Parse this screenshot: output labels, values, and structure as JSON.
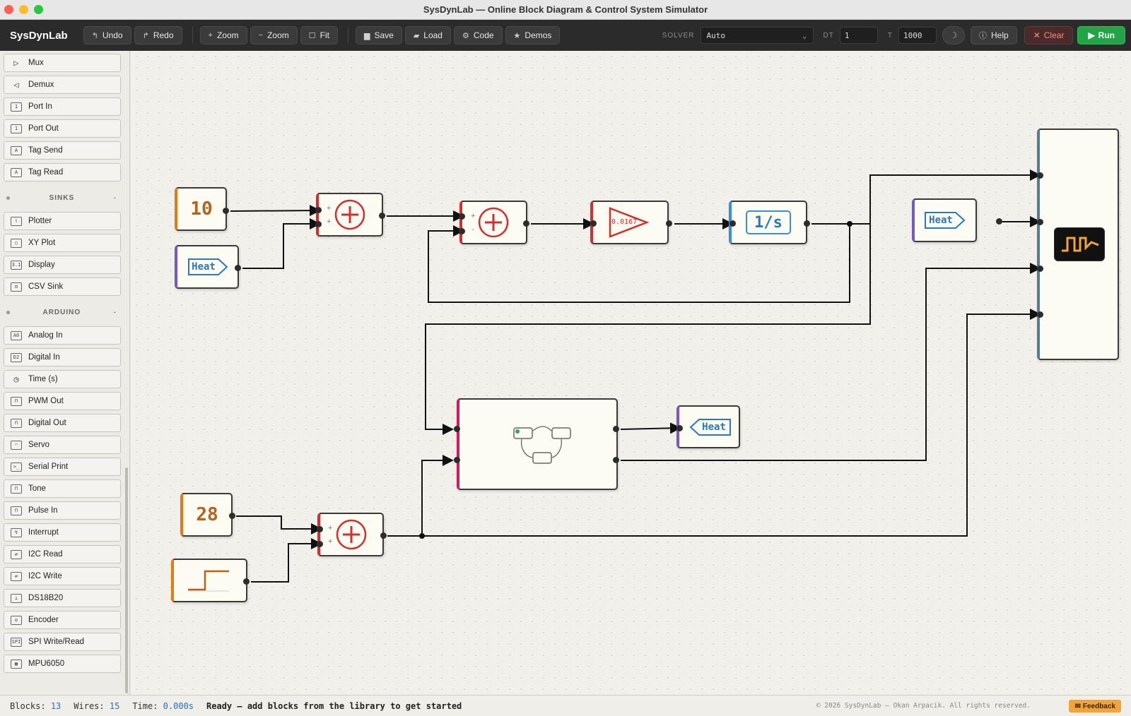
{
  "window": {
    "title": "SysDynLab — Online Block Diagram & Control System Simulator"
  },
  "toolbar": {
    "brand": "SysDynLab",
    "undo": "Undo",
    "redo": "Redo",
    "zoom_in": "Zoom",
    "zoom_out": "Zoom",
    "fit": "Fit",
    "save": "Save",
    "load": "Load",
    "code": "Code",
    "demos": "Demos",
    "solver_label": "SOLVER",
    "solver_value": "Auto",
    "dt_label": "DT",
    "dt_value": "1",
    "t_label": "T",
    "t_value": "1000",
    "help": "Help",
    "clear": "Clear",
    "run": "Run"
  },
  "sidebar": {
    "items_top": [
      "Mux",
      "Demux",
      "Port In",
      "Port Out",
      "Tag Send",
      "Tag Read"
    ],
    "section_sinks": "SINKS",
    "items_sinks": [
      "Plotter",
      "XY Plot",
      "Display",
      "CSV Sink"
    ],
    "section_arduino": "ARDUINO",
    "items_arduino": [
      "Analog In",
      "Digital In",
      "Time (s)",
      "PWM Out",
      "Digital Out",
      "Servo",
      "Serial Print",
      "Tone",
      "Pulse In",
      "Interrupt",
      "I2C Read",
      "I2C Write",
      "DS18B20",
      "Encoder",
      "SPI Write/Read",
      "MPU6050"
    ],
    "section_toggle": "-"
  },
  "canvas": {
    "const1": "10",
    "const2": "28",
    "gain": "0.0167",
    "integrator": "1/s",
    "tag_read_1": "Heat",
    "tag_read_2": "Heat",
    "tag_send": "Heat",
    "sum_signs": {
      "plus": "+",
      "minus": "-"
    }
  },
  "status": {
    "blocks_label": "Blocks:",
    "blocks": "13",
    "wires_label": "Wires:",
    "wires": "15",
    "time_label": "Time:",
    "time": "0.000s",
    "message": "Ready — add blocks from the library to get started",
    "copyright": "© 2026 SysDynLab — Okan Arpacik. All rights reserved.",
    "feedback": "Feedback"
  },
  "colors": {
    "run": "#22a447",
    "clear": "#ff8a80",
    "accent_blue": "#2d79b5",
    "sum_red": "#d2302f"
  }
}
